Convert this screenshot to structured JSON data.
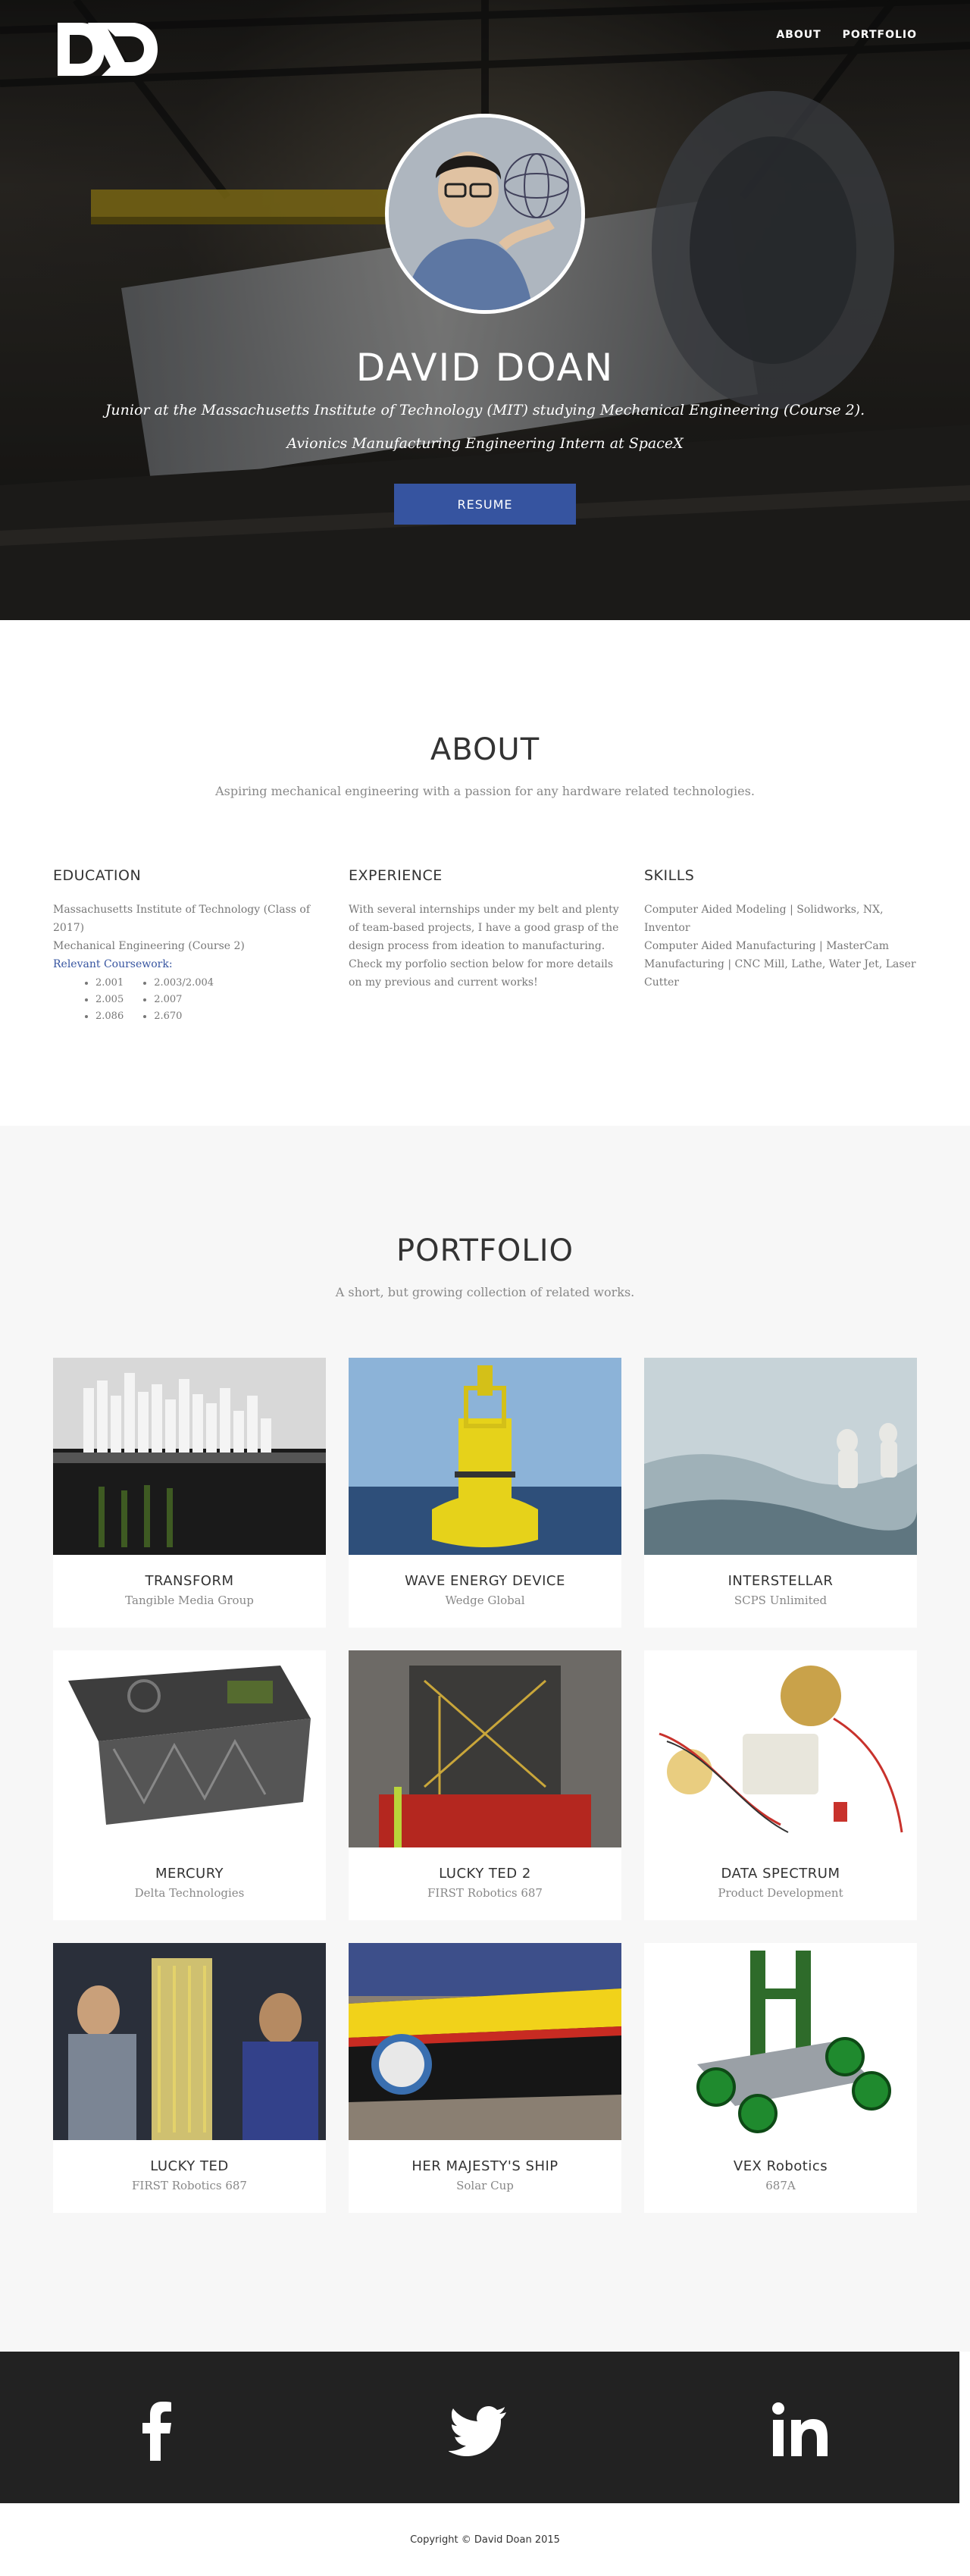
{
  "nav": {
    "items": [
      "ABOUT",
      "PORTFOLIO"
    ]
  },
  "hero": {
    "name": "DAVID DOAN",
    "line1": "Junior at the Massachusetts Institute of Technology (MIT) studying Mechanical Engineering (Course 2).",
    "line2": "Avionics Manufacturing Engineering Intern at SpaceX",
    "resume_label": "RESUME"
  },
  "about": {
    "title": "ABOUT",
    "subtitle": "Aspiring mechanical engineering with a passion for any hardware related technologies.",
    "education": {
      "heading": "EDUCATION",
      "line1": "Massachusetts Institute of Technology (Class of 2017)",
      "line2": "Mechanical Engineering (Course 2)",
      "coursework_label": "Relevant Coursework:",
      "courses_left": [
        "2.001",
        "2.005",
        "2.086"
      ],
      "courses_right": [
        "2.003/2.004",
        "2.007",
        "2.670"
      ]
    },
    "experience": {
      "heading": "EXPERIENCE",
      "text": "With several internships under my belt and plenty of team-based projects, I have a good grasp of the design process from ideation to manufacturing. Check my porfolio section below for more details on my previous and current works!"
    },
    "skills": {
      "heading": "SKILLS",
      "line1": "Computer Aided Modeling | Solidworks, NX, Inventor",
      "line2": "Computer Aided Manufacturing | MasterCam Manufacturing | CNC Mill, Lathe, Water Jet, Laser Cutter"
    }
  },
  "portfolio": {
    "title": "PORTFOLIO",
    "subtitle": "A short, but growing collection of related works.",
    "projects": [
      {
        "title": "TRANSFORM",
        "org": "Tangible Media Group"
      },
      {
        "title": "WAVE ENERGY DEVICE",
        "org": "Wedge Global"
      },
      {
        "title": "INTERSTELLAR",
        "org": "SCPS Unlimited"
      },
      {
        "title": "MERCURY",
        "org": "Delta Technologies"
      },
      {
        "title": "LUCKY TED 2",
        "org": "FIRST Robotics 687"
      },
      {
        "title": "DATA SPECTRUM",
        "org": "Product Development"
      },
      {
        "title": "LUCKY TED",
        "org": "FIRST Robotics 687"
      },
      {
        "title": "HER MAJESTY'S SHIP",
        "org": "Solar Cup"
      },
      {
        "title": "VEX Robotics",
        "org": "687A"
      }
    ]
  },
  "footer": {
    "social_icons": [
      "facebook-icon",
      "twitter-icon",
      "linkedin-icon"
    ],
    "copyright": "Copyright © David Doan 2015"
  },
  "colors": {
    "accent": "#3654a0",
    "footer_bg": "#222222",
    "portfolio_bg": "#f7f7f7"
  }
}
